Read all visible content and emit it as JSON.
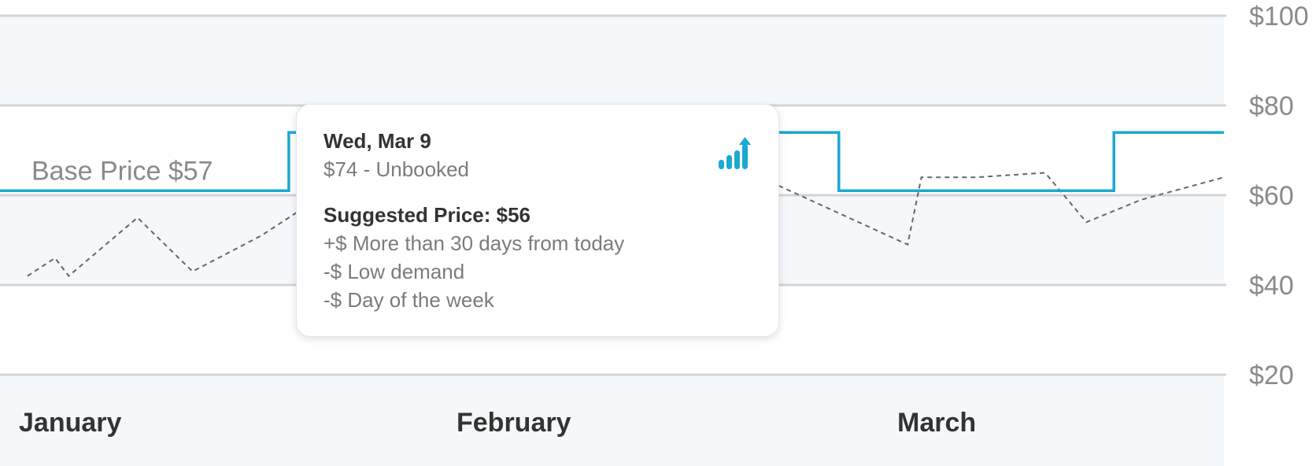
{
  "chart_data": {
    "type": "line",
    "y_axis": {
      "ticks": [
        "$100",
        "$80",
        "$60",
        "$40",
        "$20"
      ],
      "tick_values": [
        100,
        80,
        60,
        40,
        20
      ],
      "ylim": [
        20,
        100
      ],
      "side": "right",
      "grid": true
    },
    "x_axis": {
      "month_labels": [
        "January",
        "February",
        "March"
      ],
      "xlim": [
        1,
        90
      ]
    },
    "base_price": {
      "label": "Base Price $57",
      "value": 61
    },
    "series": [
      {
        "style": "solid",
        "color": "#1ba8d2",
        "x": [
          1,
          22,
          22,
          62,
          62,
          82,
          82,
          90
        ],
        "y": [
          61,
          61,
          74,
          74,
          61,
          61,
          74,
          74
        ]
      },
      {
        "style": "dashed",
        "color": "#666666",
        "x": [
          3,
          5,
          6,
          11,
          15,
          20,
          24,
          35,
          37,
          53,
          57,
          67,
          68,
          72,
          77,
          80,
          84,
          90
        ],
        "y": [
          42,
          46,
          42,
          55,
          43,
          51,
          59,
          56,
          59,
          49,
          63,
          49,
          64,
          64,
          65,
          54,
          59,
          64
        ]
      }
    ],
    "bands": [
      {
        "from": 20,
        "to": 40,
        "color": "#ffffff"
      },
      {
        "from": 40,
        "to": 60,
        "color": "#f5f8fb"
      },
      {
        "from": 60,
        "to": 80,
        "color": "#ffffff"
      },
      {
        "from": 80,
        "to": 100,
        "color": "#f5f8fb"
      }
    ]
  },
  "tooltip": {
    "date": "Wed, Mar 9",
    "price_status": "$74 - Unbooked",
    "suggested": "Suggested Price: $56",
    "factors": [
      "+$ More than 30 days from today",
      "-$ Low demand",
      "-$ Day of the week"
    ],
    "icon": "bar-chart-up-icon",
    "icon_color": "#1ba8d2"
  },
  "colors": {
    "accent": "#1ba8d2",
    "grid": "#d4d4d4",
    "band_light": "#f5f8fb",
    "axis_text": "#8a8a8a",
    "month_text": "#333333"
  }
}
